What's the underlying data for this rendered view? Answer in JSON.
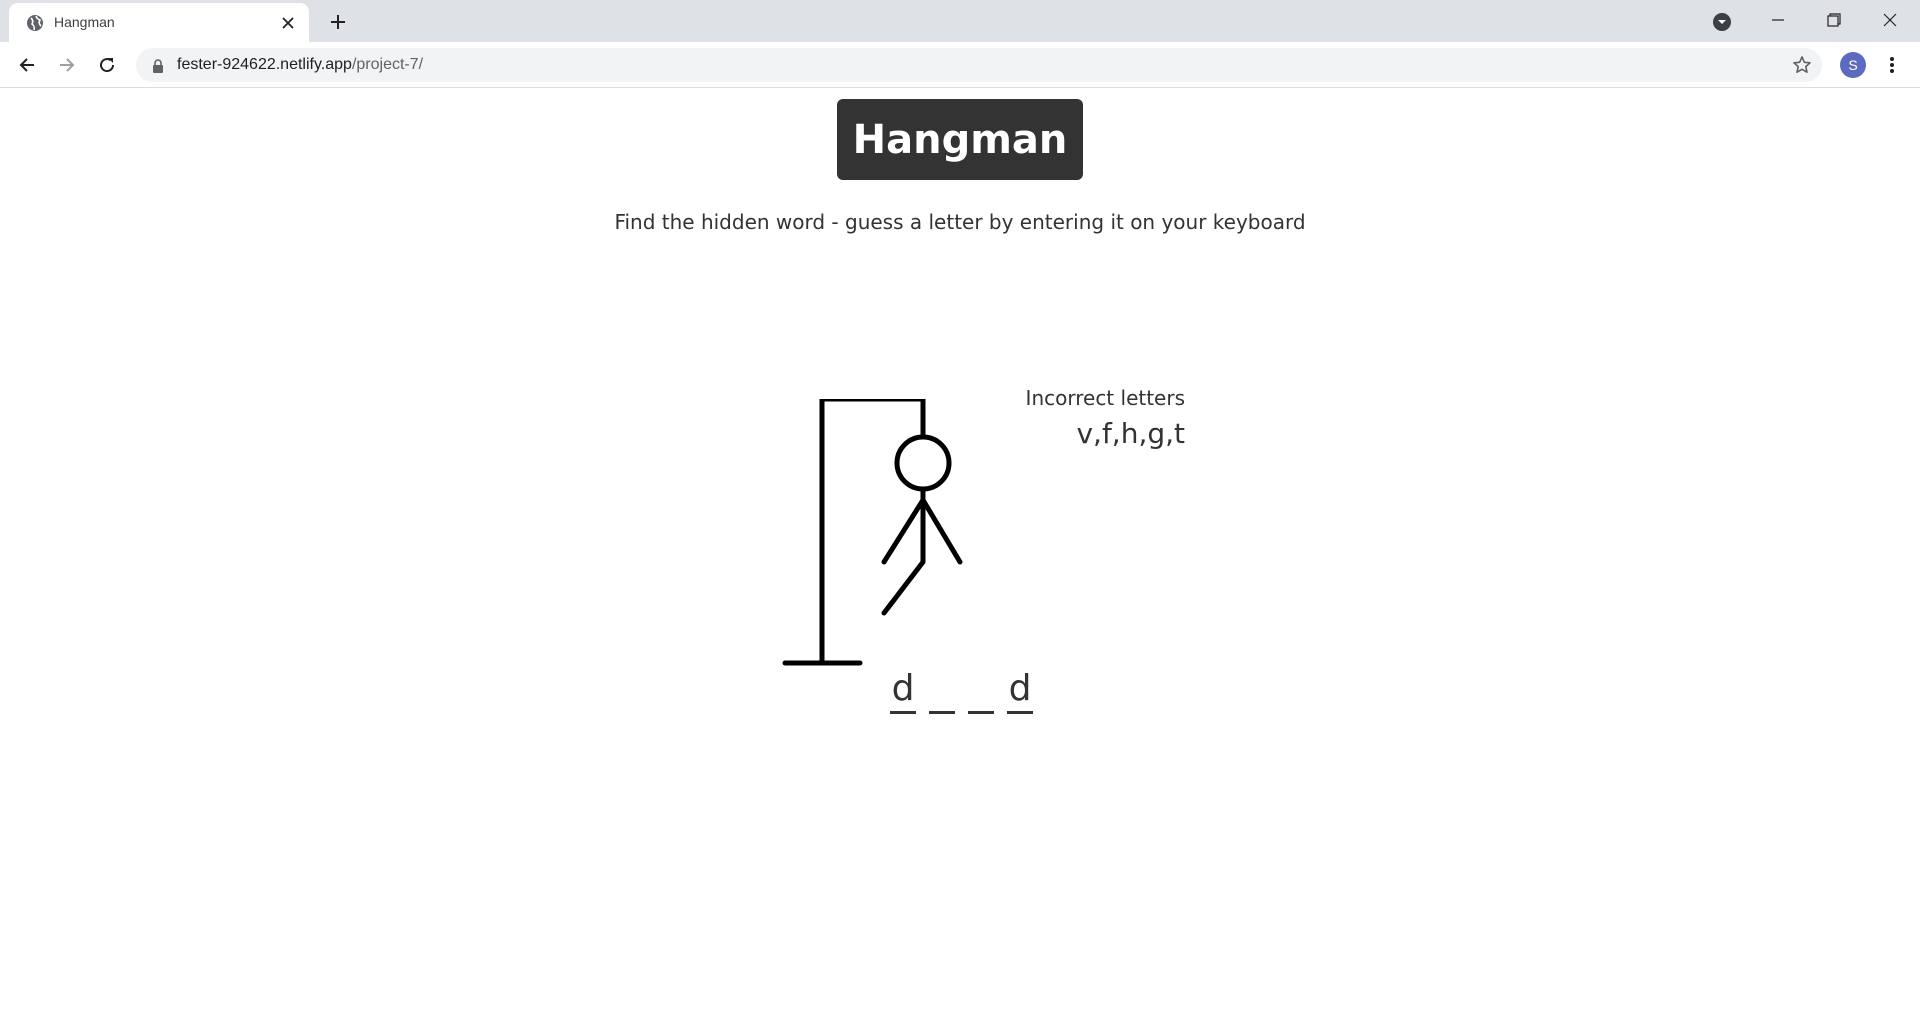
{
  "browser": {
    "tab": {
      "title": "Hangman",
      "favicon": "globe-icon"
    },
    "address_bar": {
      "host": "fester-924622.netlify.app",
      "path": "/project-7/"
    },
    "profile_initial": "S"
  },
  "game": {
    "title": "Hangman",
    "instructions": "Find the hidden word - guess a letter by entering it on your keyboard",
    "wrong_letters_title": "Incorrect letters",
    "wrong_letters": "v,f,h,g,t",
    "word_slots": [
      {
        "letter": "d"
      },
      {
        "letter": ""
      },
      {
        "letter": ""
      },
      {
        "letter": "d"
      }
    ],
    "figure_parts_shown": [
      "gallows",
      "head",
      "body",
      "left-arm",
      "right-arm",
      "left-leg"
    ]
  },
  "colors": {
    "title_background": "#333333",
    "text": "#333333",
    "tabstrip": "#dee1e6",
    "avatar": "#5c6bc0"
  }
}
